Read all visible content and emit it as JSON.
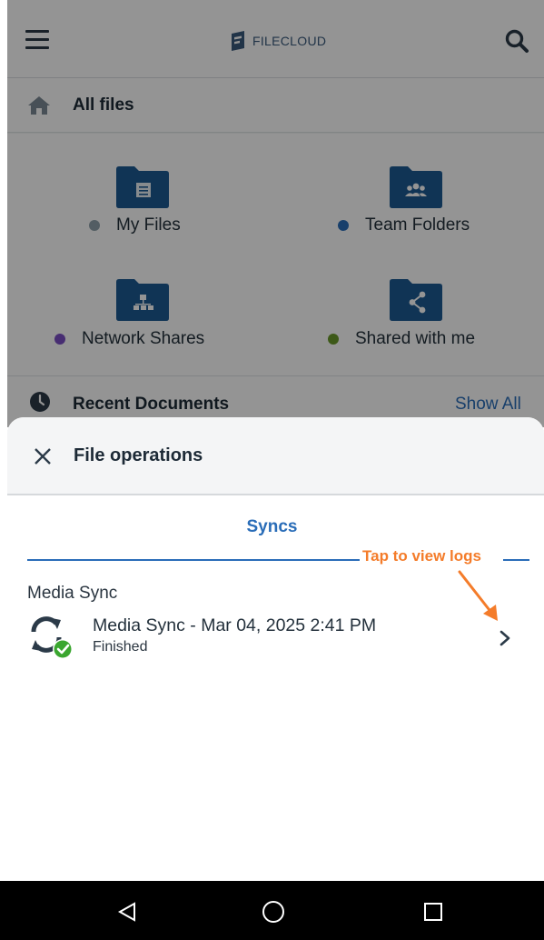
{
  "header": {
    "logo_text": "FILECLOUD",
    "menu_icon": "hamburger-menu-icon",
    "search_icon": "search-icon"
  },
  "breadcrumb": {
    "label": "All files",
    "icon": "home-icon"
  },
  "folders": [
    {
      "label": "My Files",
      "dot_color": "#8fa1ab",
      "icon": "document-folder-icon"
    },
    {
      "label": "Team Folders",
      "dot_color": "#2a6db8",
      "icon": "team-folder-icon"
    },
    {
      "label": "Network Shares",
      "dot_color": "#7a4fc4",
      "icon": "network-folder-icon"
    },
    {
      "label": "Shared with me",
      "dot_color": "#6a9a2a",
      "icon": "share-folder-icon"
    }
  ],
  "recent": {
    "label": "Recent Documents",
    "show_all": "Show All",
    "icon": "clock-icon"
  },
  "sheet": {
    "title": "File operations",
    "tab": "Syncs",
    "annotation": "Tap to view logs",
    "group_title": "Media Sync",
    "item": {
      "name": "Media Sync - Mar 04, 2025 2:41 PM",
      "status": "Finished"
    }
  },
  "colors": {
    "accent": "#2a6db8",
    "folder": "#1d5a93",
    "annotation": "#f47c2a",
    "success": "#3aa62f"
  }
}
